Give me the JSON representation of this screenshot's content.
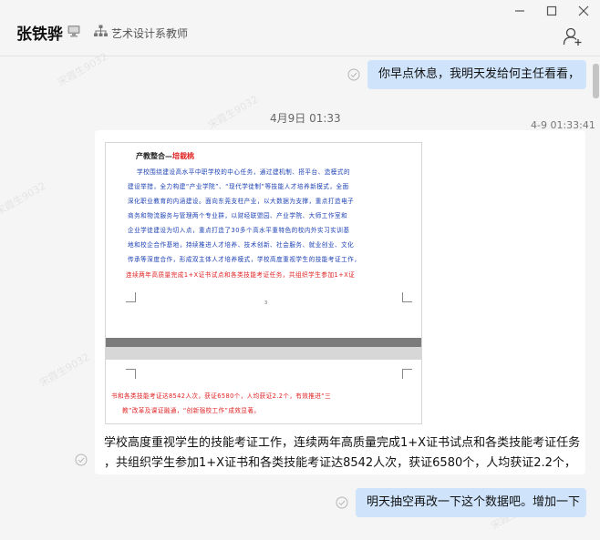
{
  "header": {
    "contact_name": "张铁骅",
    "department": "艺术设计系教师"
  },
  "watermark": "宋霞生9032",
  "messages": {
    "out1": "你早点休息，我明天发给何主任看看，",
    "date_divider": "4月9日 01:33",
    "incoming_time": "4-9 01:33:41",
    "doc": {
      "heading_prefix": "产教整合—",
      "heading_red": "培栽桃",
      "lines": [
        "学校围绕建设高水平中职学校的中心任务，通过建机制、搭平台、造模式的",
        "建设举措，全力构建“产业学院”、“现代学徒制”等技能人才培养新模式，全面",
        "深化职业教育的内涵建设。面向东莞支柱产业，以大数据为支撑，重点打造电子",
        "商务和物流服务与管理两个专业群，以财经联盟园、产业学院、大师工作室和",
        "企业学徒建设为切入点，重点打造了30多个高水平重特色的校内外实习实训基",
        "地和校企合作基地，持续推进人才培养、技术创新、社会服务、就业创业、文化",
        "传承等深度合作，形成双主体人才培养模式，学校高度重视学生的技能考证工作，"
      ],
      "red_line": "连续两年高质量完成1+X证书试点和各类技能考证任务，共组织学生参加1+X证",
      "page_number": "3",
      "page2_lines": [
        "书和各类技能考证达8542人次，获证6580个，人均获证2.2个，有效推进“三",
        "教”改革及课证融通，“创新强校工作”成效显著。"
      ]
    },
    "in_text_line1": "学校高度重视学生的技能考证工作，连续两年高质量完成1+X证书试点和各类技能考证任务",
    "in_text_line2": "，共组织学生参加1+X证书和各类技能考证达8542人次，获证6580个，人均获证2.2个，",
    "out2": "明天抽空再改一下这个数据吧。增加一下"
  }
}
